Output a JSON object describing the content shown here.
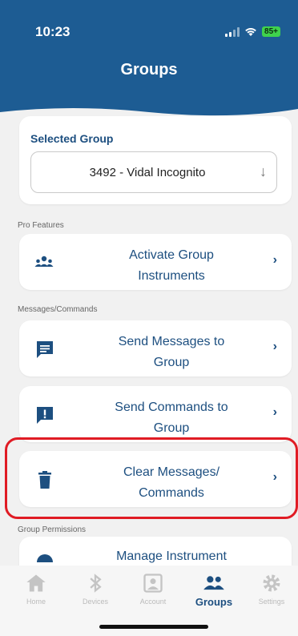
{
  "status_bar": {
    "time": "10:23",
    "battery": "85+"
  },
  "header": {
    "title": "Groups"
  },
  "selected_group": {
    "title": "Selected Group",
    "value": "3492 - Vidal Incognito",
    "arrow_icon": "arrow-down-icon"
  },
  "sections": {
    "pro_features": "Pro Features",
    "messages_commands": "Messages/Commands",
    "group_permissions": "Group Permissions"
  },
  "rows": {
    "activate_group_instruments": {
      "line1": "Activate Group",
      "line2": "Instruments",
      "icon": "group-icon"
    },
    "send_messages": {
      "line1": "Send Messages to",
      "line2": "Group",
      "icon": "message-icon"
    },
    "send_commands": {
      "line1": "Send Commands to",
      "line2": "Group",
      "icon": "alert-message-icon"
    },
    "clear_messages": {
      "line1": "Clear Messages/",
      "line2": "Commands",
      "icon": "trash-icon"
    },
    "manage_instrument": {
      "line1": "Manage Instrument",
      "icon": "gauge-icon"
    }
  },
  "tabs": [
    {
      "label": "Home",
      "icon": "home-icon"
    },
    {
      "label": "Devices",
      "icon": "bluetooth-icon"
    },
    {
      "label": "Account",
      "icon": "account-icon"
    },
    {
      "label": "Groups",
      "icon": "groups-icon",
      "active": true
    },
    {
      "label": "Settings",
      "icon": "gear-icon"
    }
  ],
  "colors": {
    "header_blue": "#1d5c93",
    "accent_blue": "#1d4f80",
    "highlight_red": "#e01b24",
    "battery_green": "#3fd24d"
  }
}
